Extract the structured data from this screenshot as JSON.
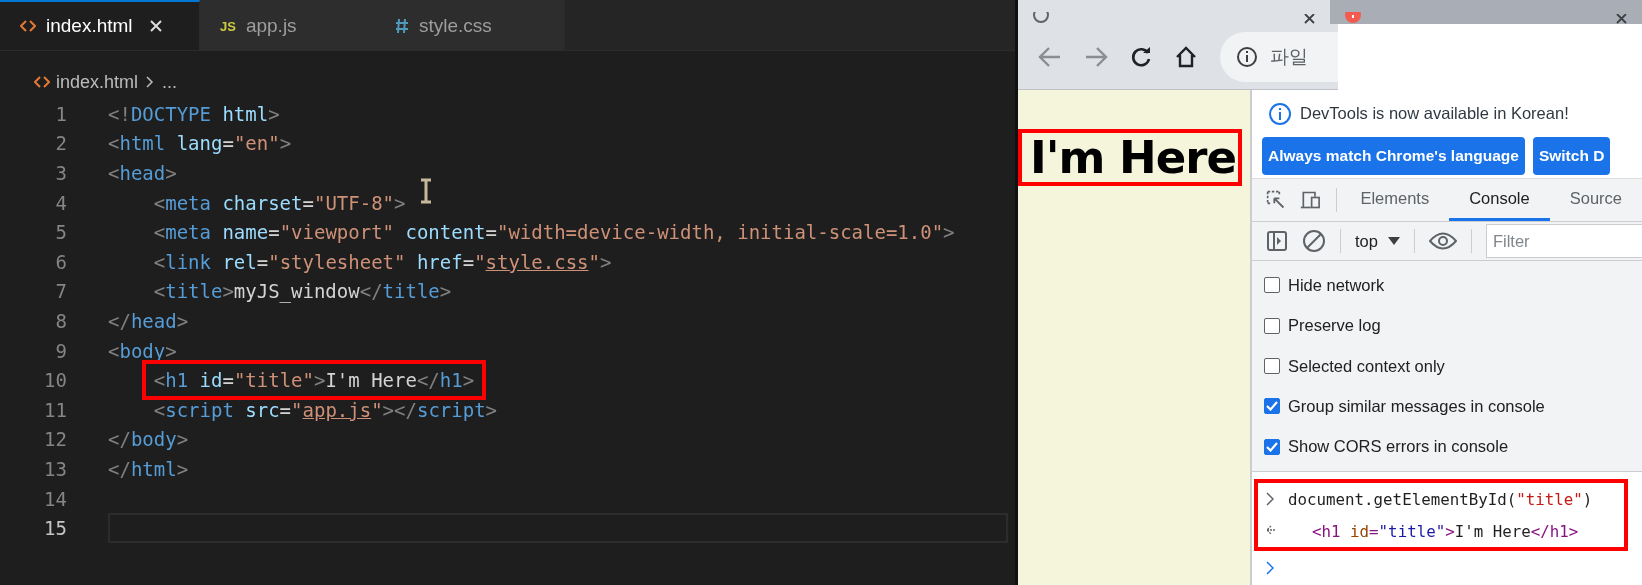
{
  "editor": {
    "tabs": [
      {
        "label": "index.html",
        "kind": "html",
        "selected": true
      },
      {
        "label": "app.js",
        "kind": "js",
        "icon_text": "JS",
        "selected": false
      },
      {
        "label": "style.css",
        "kind": "css",
        "selected": false
      }
    ],
    "breadcrumb": [
      "index.html",
      "..."
    ],
    "lines": [
      {
        "number": "1",
        "current": false,
        "annotated": false,
        "indented": false,
        "tokens": [
          {
            "text": "<!",
            "kind": "punct"
          },
          {
            "text": "DOCTYPE",
            "kind": "tag"
          },
          {
            "text": " html",
            "kind": "attr"
          },
          {
            "text": ">",
            "kind": "punct"
          }
        ]
      },
      {
        "number": "2",
        "current": false,
        "annotated": false,
        "indented": false,
        "tokens": [
          {
            "text": "<",
            "kind": "punct"
          },
          {
            "text": "html",
            "kind": "tag"
          },
          {
            "text": " lang",
            "kind": "attr"
          },
          {
            "text": "=",
            "kind": "text"
          },
          {
            "text": "\"en\"",
            "kind": "string"
          },
          {
            "text": ">",
            "kind": "punct"
          }
        ]
      },
      {
        "number": "3",
        "current": false,
        "annotated": false,
        "indented": false,
        "tokens": [
          {
            "text": "<",
            "kind": "punct"
          },
          {
            "text": "head",
            "kind": "tag"
          },
          {
            "text": ">",
            "kind": "punct"
          }
        ]
      },
      {
        "number": "4",
        "current": false,
        "annotated": false,
        "indented": true,
        "tokens": [
          {
            "text": "<",
            "kind": "punct"
          },
          {
            "text": "meta",
            "kind": "tag"
          },
          {
            "text": " charset",
            "kind": "attr"
          },
          {
            "text": "=",
            "kind": "text"
          },
          {
            "text": "\"UTF-8\"",
            "kind": "string"
          },
          {
            "text": ">",
            "kind": "punct"
          }
        ]
      },
      {
        "number": "5",
        "current": false,
        "annotated": false,
        "indented": true,
        "tokens": [
          {
            "text": "<",
            "kind": "punct"
          },
          {
            "text": "meta",
            "kind": "tag"
          },
          {
            "text": " name",
            "kind": "attr"
          },
          {
            "text": "=",
            "kind": "text"
          },
          {
            "text": "\"viewport\"",
            "kind": "string"
          },
          {
            "text": " content",
            "kind": "attr"
          },
          {
            "text": "=",
            "kind": "text"
          },
          {
            "text": "\"width=device-width, initial-scale=1.0\"",
            "kind": "string"
          },
          {
            "text": ">",
            "kind": "punct"
          }
        ]
      },
      {
        "number": "6",
        "current": false,
        "annotated": false,
        "indented": true,
        "tokens": [
          {
            "text": "<",
            "kind": "punct"
          },
          {
            "text": "link",
            "kind": "tag"
          },
          {
            "text": " rel",
            "kind": "attr"
          },
          {
            "text": "=",
            "kind": "text"
          },
          {
            "text": "\"stylesheet\"",
            "kind": "string"
          },
          {
            "text": " href",
            "kind": "attr"
          },
          {
            "text": "=",
            "kind": "text"
          },
          {
            "text": "\"",
            "kind": "string"
          },
          {
            "text": "style.css",
            "kind": "link"
          },
          {
            "text": "\"",
            "kind": "string"
          },
          {
            "text": ">",
            "kind": "punct"
          }
        ]
      },
      {
        "number": "7",
        "current": false,
        "annotated": false,
        "indented": true,
        "tokens": [
          {
            "text": "<",
            "kind": "punct"
          },
          {
            "text": "title",
            "kind": "tag"
          },
          {
            "text": ">",
            "kind": "punct"
          },
          {
            "text": "myJS_window",
            "kind": "text"
          },
          {
            "text": "</",
            "kind": "punct"
          },
          {
            "text": "title",
            "kind": "tag"
          },
          {
            "text": ">",
            "kind": "punct"
          }
        ]
      },
      {
        "number": "8",
        "current": false,
        "annotated": false,
        "indented": false,
        "tokens": [
          {
            "text": "</",
            "kind": "punct"
          },
          {
            "text": "head",
            "kind": "tag"
          },
          {
            "text": ">",
            "kind": "punct"
          }
        ]
      },
      {
        "number": "9",
        "current": false,
        "annotated": false,
        "indented": false,
        "tokens": [
          {
            "text": "<",
            "kind": "punct"
          },
          {
            "text": "body",
            "kind": "tag"
          },
          {
            "text": ">",
            "kind": "punct"
          }
        ]
      },
      {
        "number": "10",
        "current": false,
        "annotated": true,
        "indented": true,
        "tokens": [
          {
            "text": "<",
            "kind": "punct"
          },
          {
            "text": "h1",
            "kind": "tag"
          },
          {
            "text": " id",
            "kind": "attr"
          },
          {
            "text": "=",
            "kind": "text"
          },
          {
            "text": "\"title\"",
            "kind": "string"
          },
          {
            "text": ">",
            "kind": "punct"
          },
          {
            "text": "I'm Here",
            "kind": "text"
          },
          {
            "text": "</",
            "kind": "punct"
          },
          {
            "text": "h1",
            "kind": "tag"
          },
          {
            "text": ">",
            "kind": "punct"
          }
        ]
      },
      {
        "number": "11",
        "current": false,
        "annotated": false,
        "indented": true,
        "tokens": [
          {
            "text": "<",
            "kind": "punct"
          },
          {
            "text": "script",
            "kind": "tag"
          },
          {
            "text": " src",
            "kind": "attr"
          },
          {
            "text": "=",
            "kind": "text"
          },
          {
            "text": "\"",
            "kind": "string"
          },
          {
            "text": "app.js",
            "kind": "link"
          },
          {
            "text": "\"",
            "kind": "string"
          },
          {
            "text": "></",
            "kind": "punct"
          },
          {
            "text": "script",
            "kind": "tag"
          },
          {
            "text": ">",
            "kind": "punct"
          }
        ]
      },
      {
        "number": "12",
        "current": false,
        "annotated": false,
        "indented": false,
        "tokens": [
          {
            "text": "</",
            "kind": "punct"
          },
          {
            "text": "body",
            "kind": "tag"
          },
          {
            "text": ">",
            "kind": "punct"
          }
        ]
      },
      {
        "number": "13",
        "current": false,
        "annotated": false,
        "indented": false,
        "tokens": [
          {
            "text": "</",
            "kind": "punct"
          },
          {
            "text": "html",
            "kind": "tag"
          },
          {
            "text": ">",
            "kind": "punct"
          }
        ]
      },
      {
        "number": "14",
        "current": false
      },
      {
        "number": "15",
        "current": true
      }
    ]
  },
  "browser": {
    "tabs": [
      {
        "kind": "page",
        "selected": true
      },
      {
        "kind": "alert",
        "selected": false
      }
    ],
    "address": {
      "scheme_label": "파일"
    },
    "page": {
      "heading": "I'm Here"
    },
    "devtools": {
      "notice": "DevTools is now available in Korean!",
      "notice_buttons": [
        "Always match Chrome's language",
        "Switch D"
      ],
      "tabs": [
        {
          "label": "Elements",
          "selected": false
        },
        {
          "label": "Console",
          "selected": true
        },
        {
          "label": "Source",
          "selected": false
        }
      ],
      "context": "top",
      "filter": {
        "placeholder": "Filter"
      },
      "settings": [
        {
          "label": "Hide network",
          "checked": false
        },
        {
          "label": "Preserve log",
          "checked": false
        },
        {
          "label": "Selected context only",
          "checked": false
        },
        {
          "label": "Group similar messages in console",
          "checked": true
        },
        {
          "label": "Show CORS errors in console",
          "checked": true
        }
      ],
      "console": [
        {
          "kind": "input",
          "tokens": [
            {
              "text": "document.getElementById(",
              "kind": "plain"
            },
            {
              "text": "\"title\"",
              "kind": "string"
            },
            {
              "text": ")",
              "kind": "plain"
            }
          ]
        },
        {
          "kind": "result",
          "tokens": [
            {
              "text": "<h1",
              "kind": "tag"
            },
            {
              "text": " id",
              "kind": "attr"
            },
            {
              "text": "=",
              "kind": "tag"
            },
            {
              "text": "\"title\"",
              "kind": "value"
            },
            {
              "text": ">",
              "kind": "tag"
            },
            {
              "text": "I'm Here",
              "kind": "plain"
            },
            {
              "text": "</h1>",
              "kind": "tag"
            }
          ]
        }
      ],
      "annotated": true
    }
  }
}
